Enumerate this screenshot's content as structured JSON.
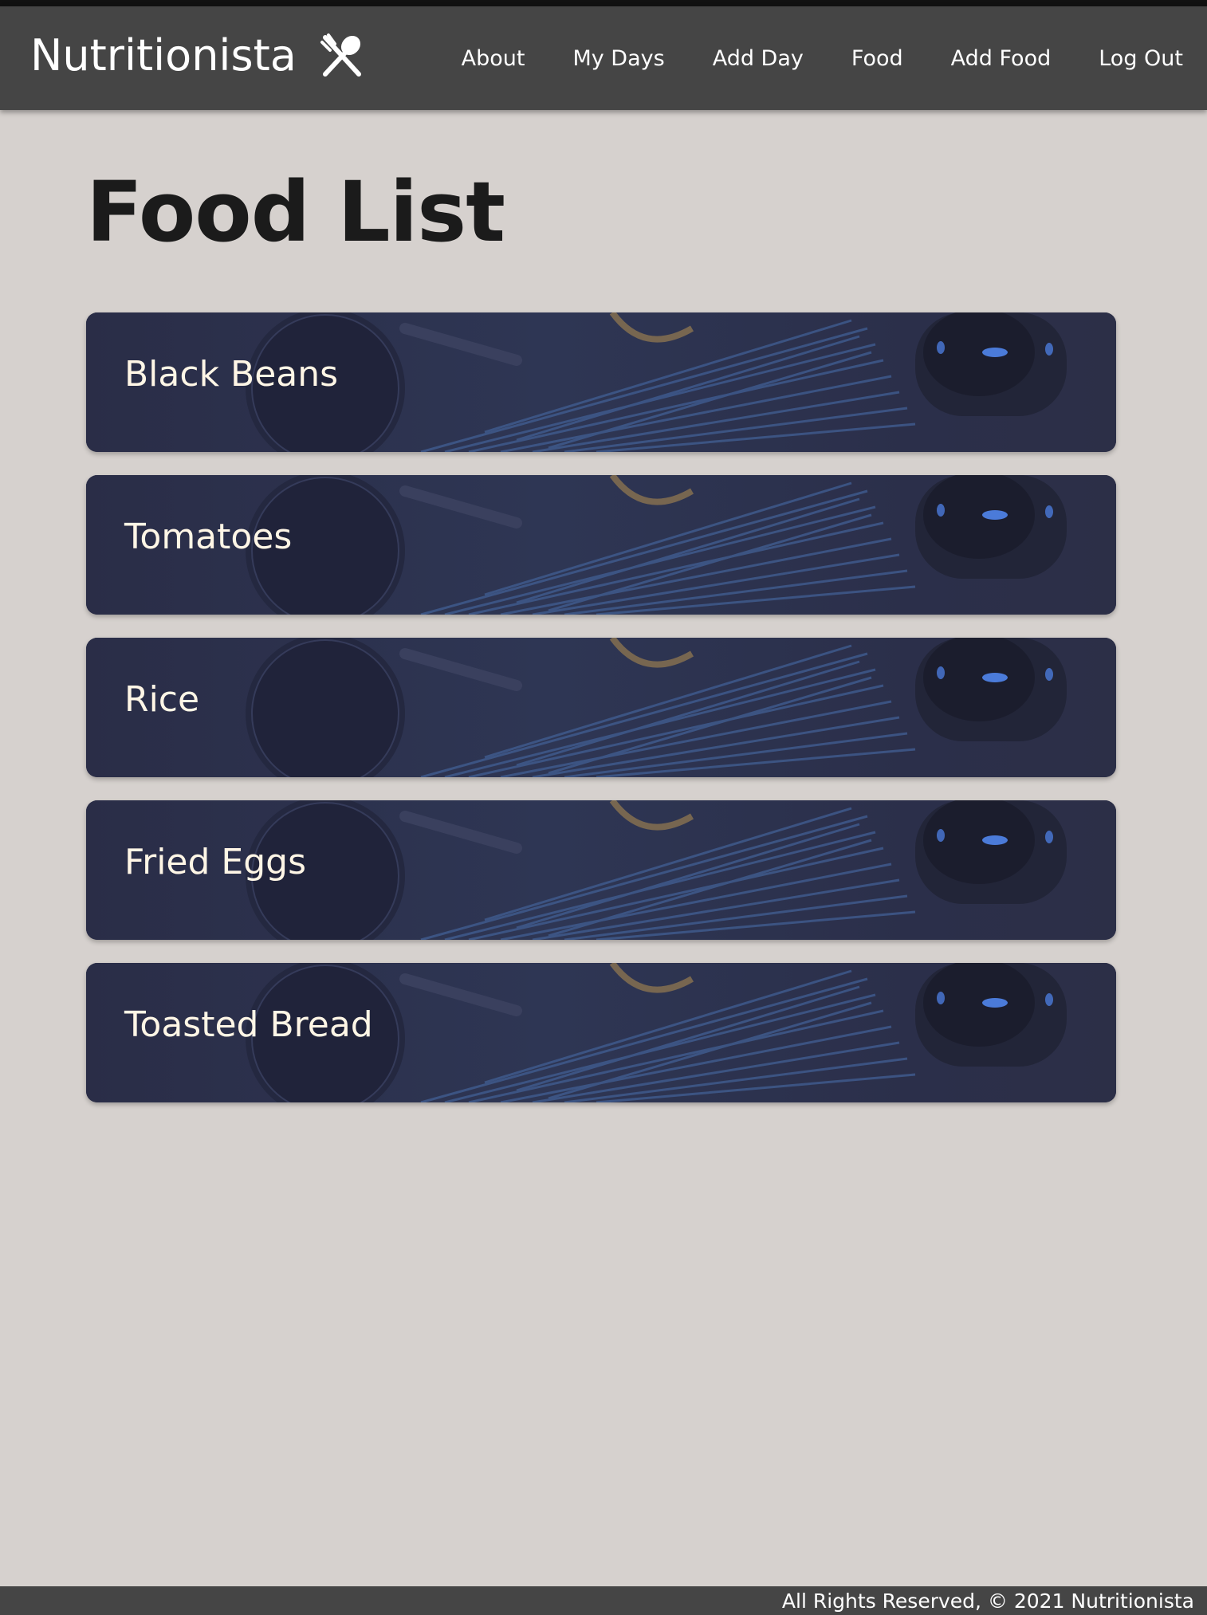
{
  "brand": {
    "name": "Nutritionista",
    "icon": "fork-spoon-icon"
  },
  "nav": {
    "links": [
      "About",
      "My Days",
      "Add Day",
      "Food",
      "Add Food",
      "Log Out"
    ]
  },
  "page": {
    "title": "Food List"
  },
  "foods": [
    "Black Beans",
    "Tomatoes",
    "Rice",
    "Fried Eggs",
    "Toasted Bread"
  ],
  "footer": {
    "text": "All Rights Reserved, © 2021 Nutritionista"
  },
  "colors": {
    "navbar": "#454545",
    "page_background": "#d6d1ce",
    "card_background": "#2b2f49",
    "card_text": "#fff6e6",
    "title_text": "#1b1b1b"
  }
}
